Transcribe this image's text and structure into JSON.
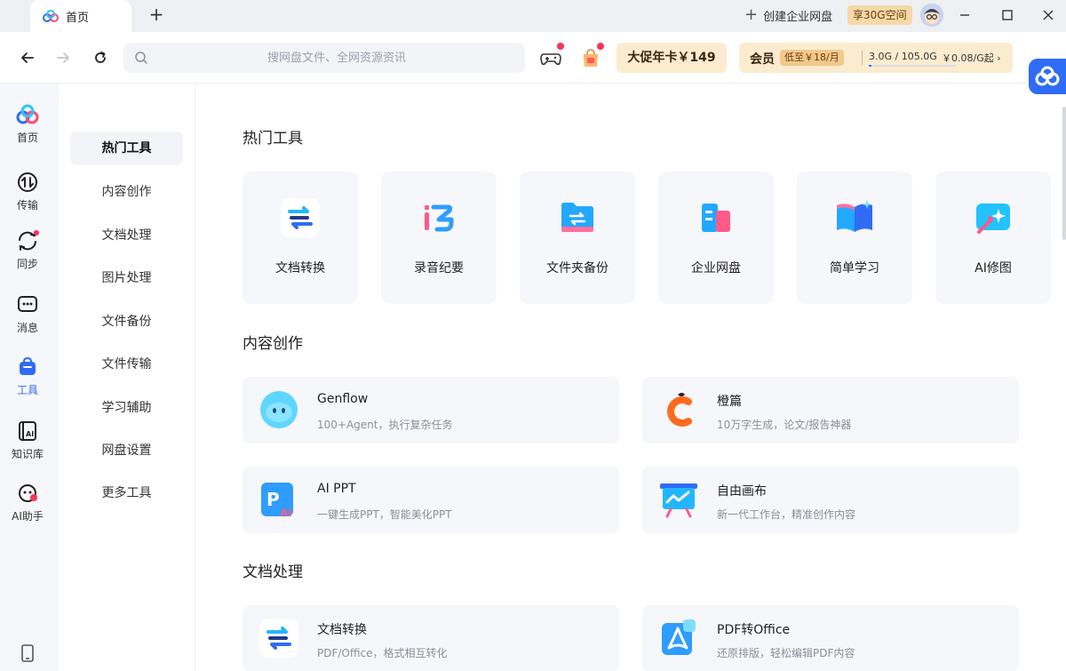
{
  "titlebar": {
    "tab_label": "首页",
    "add_tab": "+",
    "create_enterprise": "创建企业网盘",
    "space_badge": "享30G空间",
    "window_controls": [
      "minimize-icon",
      "maximize-icon",
      "close-icon"
    ]
  },
  "toolbar": {
    "search_placeholder": "搜网盘文件、全网资源资讯",
    "promo_label": "大促年卡￥149",
    "member": {
      "label": "会员",
      "price": "低至￥18/月",
      "storage": "3.0G / 105.0G",
      "rate": "￥0.08/G起 ›",
      "used_fraction": 0.029
    }
  },
  "rail": {
    "items": [
      {
        "label": "首页",
        "icon": "home-cloud-icon"
      },
      {
        "label": "传输",
        "icon": "transfer-icon"
      },
      {
        "label": "同步",
        "icon": "sync-icon"
      },
      {
        "label": "消息",
        "icon": "message-icon"
      },
      {
        "label": "工具",
        "icon": "tools-icon",
        "active": true
      },
      {
        "label": "知识库",
        "icon": "knowledge-icon"
      },
      {
        "label": "AI助手",
        "icon": "ai-assistant-icon"
      }
    ]
  },
  "categories": [
    "热门工具",
    "内容创作",
    "文档处理",
    "图片处理",
    "文件备份",
    "文件传输",
    "学习辅助",
    "网盘设置",
    "更多工具"
  ],
  "hot_tools": {
    "title": "热门工具",
    "items": [
      {
        "label": "文档转换",
        "icon": "doc-convert-icon"
      },
      {
        "label": "录音纪要",
        "icon": "record-notes-icon"
      },
      {
        "label": "文件夹备份",
        "icon": "folder-backup-icon"
      },
      {
        "label": "企业网盘",
        "icon": "enterprise-disk-icon"
      },
      {
        "label": "简单学习",
        "icon": "study-book-icon"
      },
      {
        "label": "AI修图",
        "icon": "ai-photo-icon"
      }
    ]
  },
  "content_creation": {
    "title": "内容创作",
    "items": [
      {
        "title": "Genflow",
        "desc": "100+Agent，执行复杂任务",
        "icon": "genflow-icon"
      },
      {
        "title": "橙篇",
        "desc": "10万字生成，论文/报告神器",
        "icon": "chengpian-icon"
      },
      {
        "title": "AI PPT",
        "desc": "一键生成PPT，智能美化PPT",
        "icon": "ai-ppt-icon"
      },
      {
        "title": "自由画布",
        "desc": "新一代工作台，精准创作内容",
        "icon": "canvas-icon"
      }
    ]
  },
  "doc_processing": {
    "title": "文档处理",
    "items": [
      {
        "title": "文档转换",
        "desc": "PDF/Office，格式相互转化",
        "icon": "doc-convert-icon"
      },
      {
        "title": "PDF转Office",
        "desc": "还原排版，轻松编辑PDF内容",
        "icon": "pdf-to-office-icon"
      }
    ]
  }
}
